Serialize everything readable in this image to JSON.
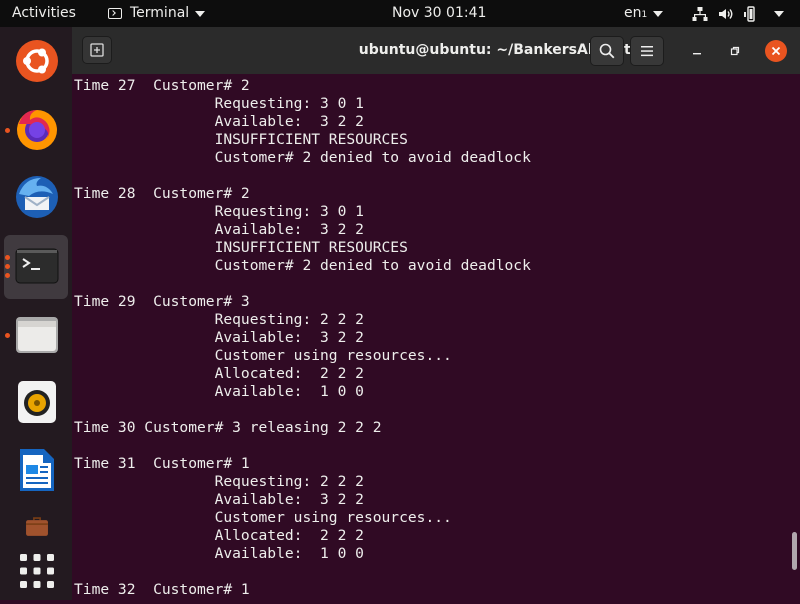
{
  "topbar": {
    "activities": "Activities",
    "app_name": "Terminal",
    "clock": "Nov 30  01:41",
    "language": "en",
    "language_sub": "1"
  },
  "dock": {
    "items": [
      {
        "name": "ubuntu-software",
        "running": false
      },
      {
        "name": "firefox",
        "running": true
      },
      {
        "name": "thunderbird",
        "running": false
      },
      {
        "name": "terminal",
        "running": true,
        "active": true
      },
      {
        "name": "files",
        "running": true
      },
      {
        "name": "rhythmbox",
        "running": false
      },
      {
        "name": "libreoffice-writer",
        "running": false
      },
      {
        "name": "software-center",
        "running": false
      },
      {
        "name": "show-applications",
        "running": false
      }
    ]
  },
  "window": {
    "title": "ubuntu@ubuntu: ~/BankersAlgorithm"
  },
  "terminal": {
    "lines": [
      "Time 27  Customer# 2",
      "                Requesting: 3 0 1",
      "                Available:  3 2 2",
      "                INSUFFICIENT RESOURCES",
      "                Customer# 2 denied to avoid deadlock",
      "",
      "Time 28  Customer# 2",
      "                Requesting: 3 0 1",
      "                Available:  3 2 2",
      "                INSUFFICIENT RESOURCES",
      "                Customer# 2 denied to avoid deadlock",
      "",
      "Time 29  Customer# 3",
      "                Requesting: 2 2 2",
      "                Available:  3 2 2",
      "                Customer using resources...",
      "                Allocated:  2 2 2",
      "                Available:  1 0 0",
      "",
      "Time 30 Customer# 3 releasing 2 2 2",
      "",
      "Time 31  Customer# 1",
      "                Requesting: 2 2 2",
      "                Available:  3 2 2",
      "                Customer using resources...",
      "                Allocated:  2 2 2",
      "                Available:  1 0 0",
      "",
      "Time 32  Customer# 1"
    ]
  },
  "colors": {
    "terminal_bg": "#300a24",
    "terminal_fg": "#eeeeec",
    "accent": "#e95420"
  }
}
